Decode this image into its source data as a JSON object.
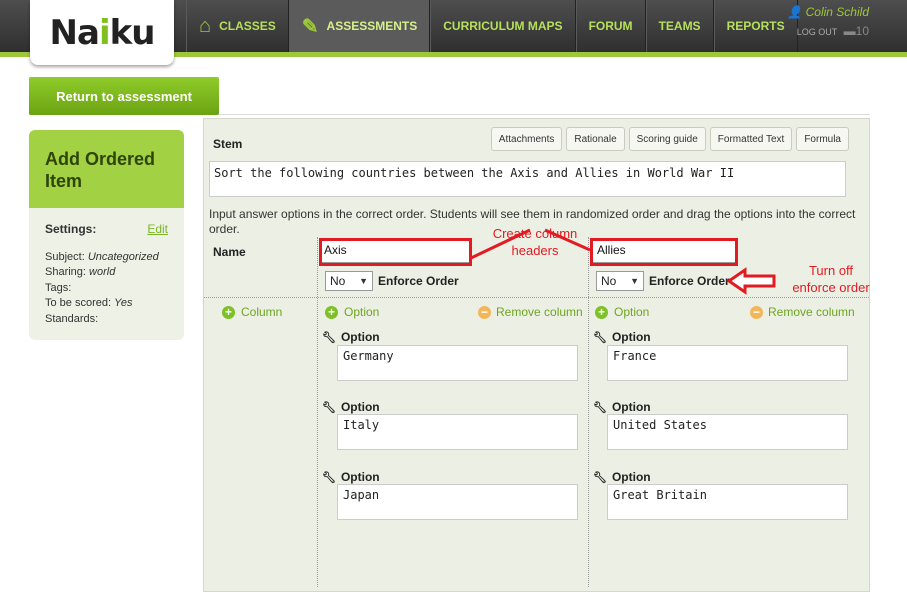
{
  "app": {
    "logo": {
      "before": "Na",
      "accent": "i",
      "after": "ku"
    }
  },
  "nav": {
    "items": [
      {
        "label": "CLASSES",
        "icon": "home-icon"
      },
      {
        "label": "ASSESSMENTS",
        "icon": "ruler-pencil-icon",
        "active": true
      },
      {
        "label": "CURRICULUM MAPS"
      },
      {
        "label": "FORUM"
      },
      {
        "label": "TEAMS"
      },
      {
        "label": "REPORTS"
      }
    ],
    "user": {
      "name": "Colin Schild",
      "logout": "LOG OUT",
      "count": "10"
    }
  },
  "return_button": "Return to assessment",
  "side": {
    "title": "Add Ordered Item",
    "settings_label": "Settings:",
    "edit_label": "Edit",
    "subject_label": "Subject:",
    "subject_value": "Uncategorized",
    "sharing_label": "Sharing:",
    "sharing_value": "world",
    "tags_label": "Tags:",
    "scored_label": "To be scored:",
    "scored_value": "Yes",
    "standards_label": "Standards:"
  },
  "editor": {
    "stem_label": "Stem",
    "tools": [
      "Attachments",
      "Rationale",
      "Scoring guide",
      "Formatted Text",
      "Formula"
    ],
    "stem_text": "Sort the following countries between the Axis and Allies in World War II",
    "instructions": "Input answer options in the correct order. Students will see them in randomized order and drag the options into the correct order.",
    "name_label": "Name",
    "add_column": "Column",
    "columns": [
      {
        "header": "Axis",
        "enforce_value": "No",
        "enforce_label": "Enforce Order",
        "add_option": "Option",
        "remove_column": "Remove column",
        "option_label": "Option",
        "options": [
          "Germany",
          "Italy",
          "Japan"
        ]
      },
      {
        "header": "Allies",
        "enforce_value": "No",
        "enforce_label": "Enforce Order",
        "add_option": "Option",
        "remove_column": "Remove column",
        "option_label": "Option",
        "options": [
          "France",
          "United States",
          "Great Britain"
        ]
      }
    ]
  },
  "annotations": {
    "headers_note_line1": "Create column",
    "headers_note_line2": "headers",
    "enforce_note_line1": "Turn off",
    "enforce_note_line2": "enforce order"
  },
  "colors": {
    "accent": "#9cc83a",
    "annotation": "#e21b23"
  }
}
